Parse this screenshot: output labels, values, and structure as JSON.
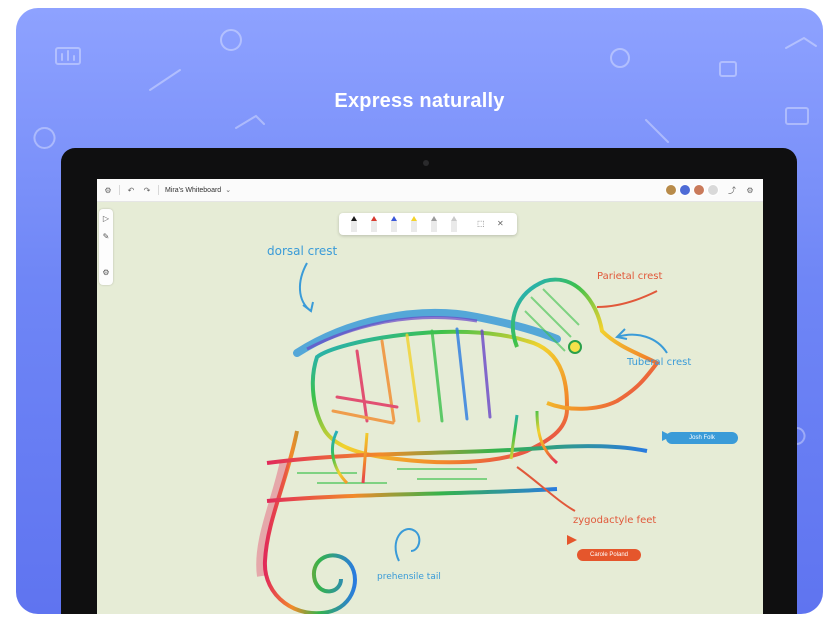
{
  "headline": "Express naturally",
  "colors": {
    "card_top": "#8ea2ff",
    "card_bottom": "#5f74f0",
    "canvas": "#e6ecd6",
    "annotation": "#3a9bd8",
    "annotation_orange": "#e1583a",
    "follow_blue": "#3a9bd8",
    "follow_orange": "#e5562c"
  },
  "whiteboard": {
    "title": "Mira's Whiteboard",
    "topbar_icons": [
      "settings-icon",
      "undo-icon",
      "redo-icon"
    ],
    "participants": [
      "avatar-1",
      "avatar-2",
      "avatar-3",
      "avatar-more"
    ],
    "right_icons": [
      "share-icon",
      "settings-gear-icon"
    ],
    "left_tools": [
      "select-tool-icon",
      "pen-tool-icon",
      "settings-tool-icon"
    ],
    "pen_tray": {
      "pens": [
        {
          "name": "black-pen",
          "color": "#1a1a1a"
        },
        {
          "name": "red-pen",
          "color": "#d73b2f"
        },
        {
          "name": "blue-pen",
          "color": "#3b57d9"
        },
        {
          "name": "yellow-highlighter",
          "color": "#f4d32b"
        },
        {
          "name": "gray-pen",
          "color": "#9b9b9b"
        },
        {
          "name": "eraser",
          "color": "#c9c9c9"
        }
      ],
      "tray_icons": [
        "lasso-icon",
        "close-icon"
      ]
    }
  },
  "annotations": {
    "dorsal": "dorsal crest",
    "parietal": "Parietal crest",
    "tubercular": "Tuberal crest",
    "prehensile": "prehensile tail",
    "zygodactyl": "zygodactyle feet"
  },
  "follow_pills": {
    "blue": "Josh Folk",
    "orange": "Carole Poland"
  }
}
